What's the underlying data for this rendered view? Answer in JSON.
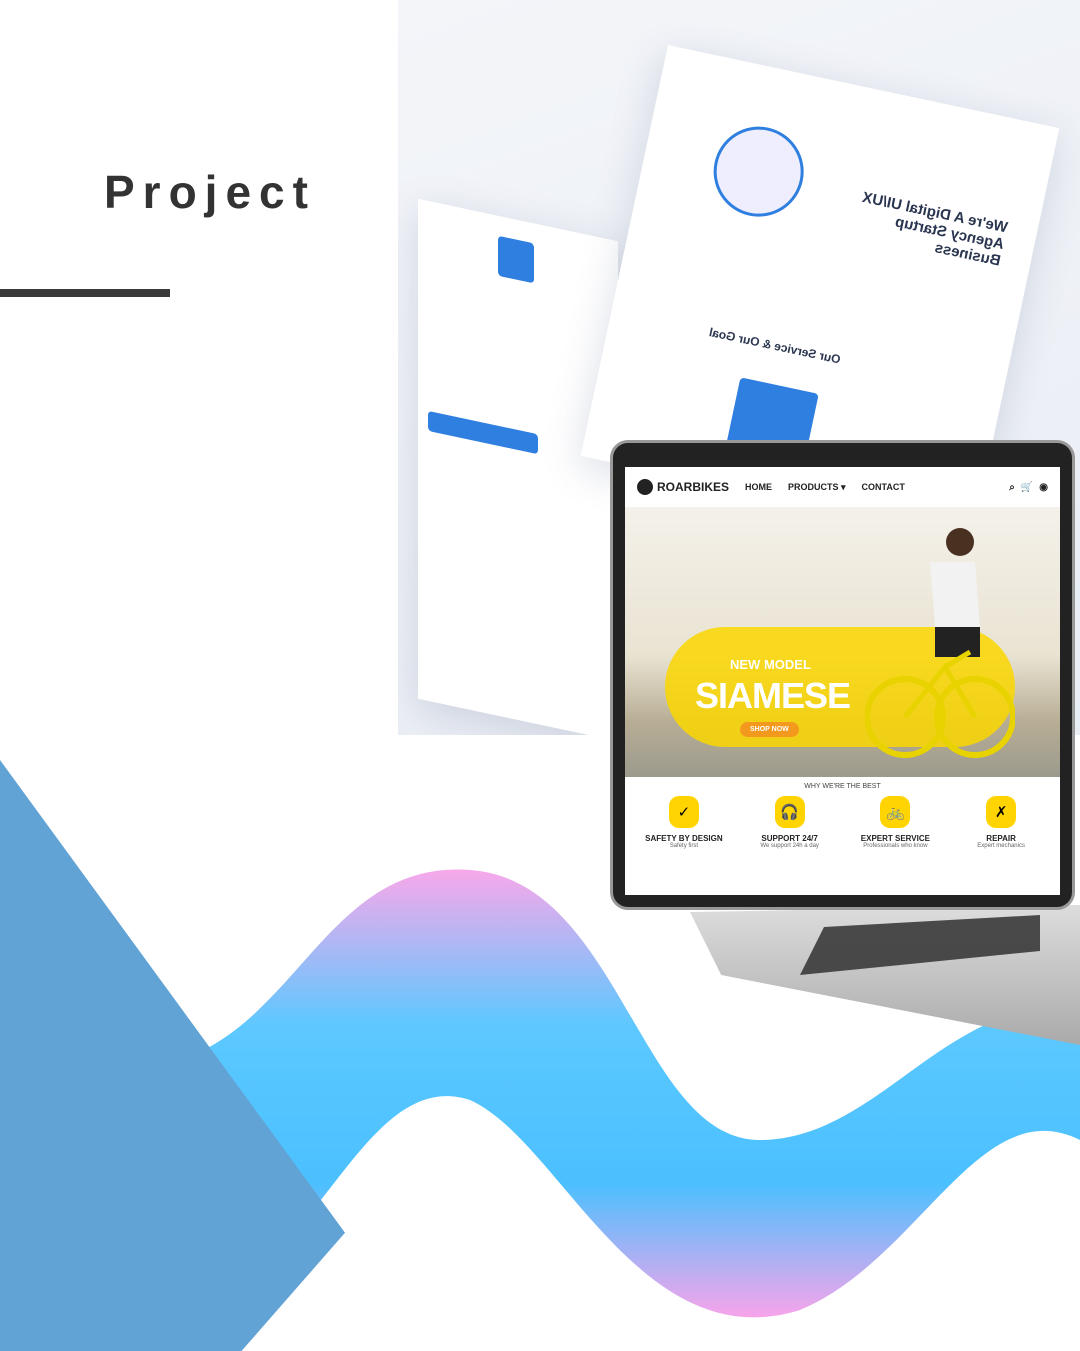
{
  "heading": "Project",
  "mockup": {
    "headline": "We're A Digital UI/UX Agency Startup Business",
    "section_title": "Our Service & Our Goal"
  },
  "laptop_site": {
    "brand": "ROARBIKES",
    "nav": [
      "HOME",
      "PRODUCTS ▾",
      "CONTACT"
    ],
    "icons": [
      "search-icon",
      "cart-icon",
      "user-icon"
    ],
    "hero": {
      "kicker": "NEW MODEL",
      "title": "SIAMESE",
      "cta": "SHOP NOW"
    },
    "why_title": "WHY WE'RE THE BEST",
    "features": [
      {
        "icon": "✓",
        "title": "SAFETY BY DESIGN",
        "sub": "Safety first"
      },
      {
        "icon": "🎧",
        "title": "SUPPORT 24/7",
        "sub": "We support 24h a day"
      },
      {
        "icon": "🚲",
        "title": "EXPERT SERVICE",
        "sub": "Professionals who know"
      },
      {
        "icon": "✗",
        "title": "REPAIR",
        "sub": "Expert mechanics"
      }
    ]
  },
  "colors": {
    "accent_blue": "#62a3d6",
    "brand_yellow": "#ffd400",
    "cta_orange": "#f39a1e"
  }
}
